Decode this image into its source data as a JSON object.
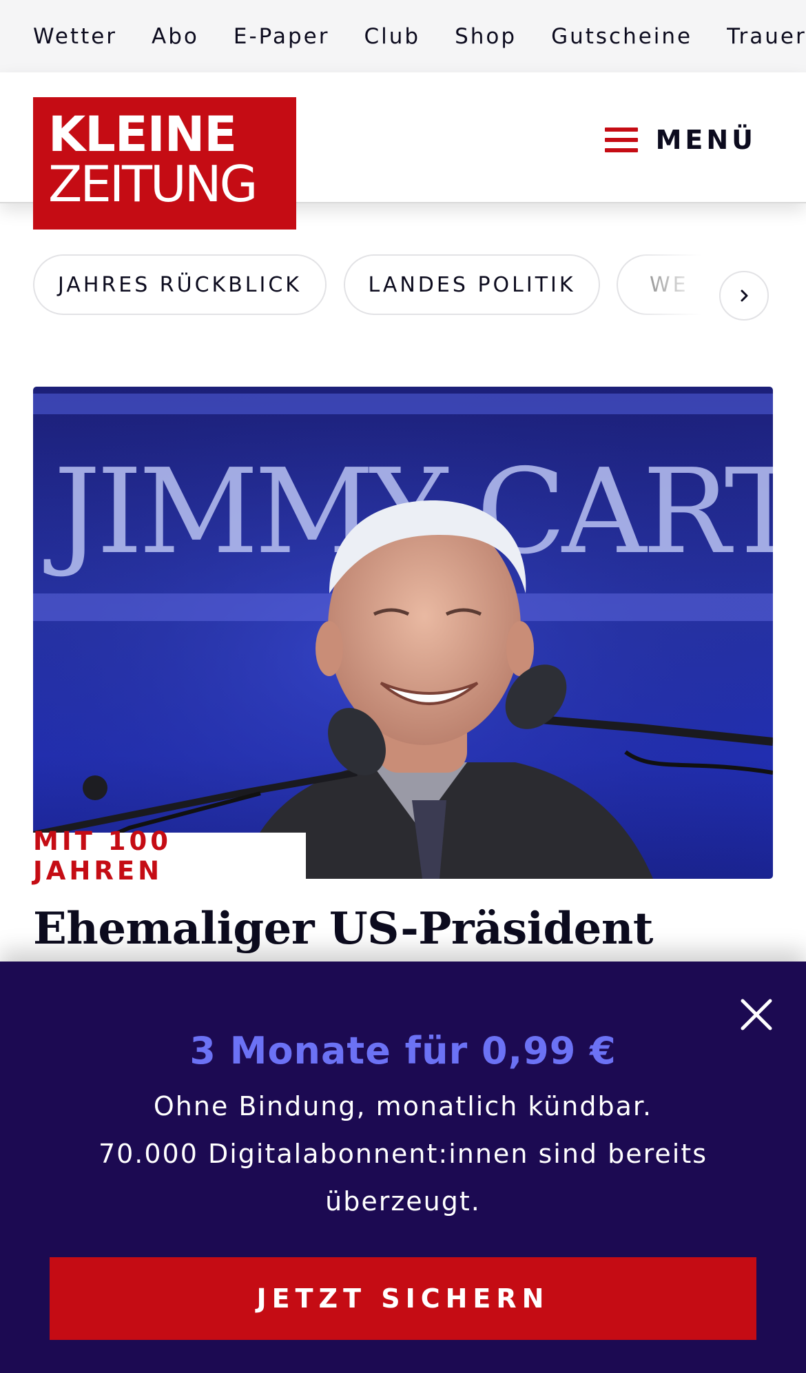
{
  "topbar": {
    "links": [
      "Wetter",
      "Abo",
      "E-Paper",
      "Club",
      "Shop",
      "Gutscheine",
      "Trauerportal"
    ]
  },
  "header": {
    "logo_line1": "KLEINE",
    "logo_line2": "ZEITUNG",
    "menu_label": "MENÜ"
  },
  "chips": {
    "items": [
      "JAHRES RÜCKBLICK",
      "LANDES POLITIK",
      "WE"
    ]
  },
  "article": {
    "image_banner_text": "JIMMY CARTER",
    "kicker": "MIT 100 JAHREN",
    "headline": "Ehemaliger US-Präsident"
  },
  "promo": {
    "title": "3 Monate für 0,99 €",
    "line1": "Ohne Bindung, monatlich kündbar.",
    "line2": "70.000 Digitalabonnent:innen sind bereits",
    "line3": "überzeugt.",
    "cta": "JETZT SICHERN"
  },
  "colors": {
    "brand_red": "#c50c14",
    "promo_bg": "#1c0a52",
    "promo_accent": "#6c72f5"
  },
  "icons": [
    "hamburger-icon",
    "chevron-right-icon",
    "close-icon"
  ]
}
